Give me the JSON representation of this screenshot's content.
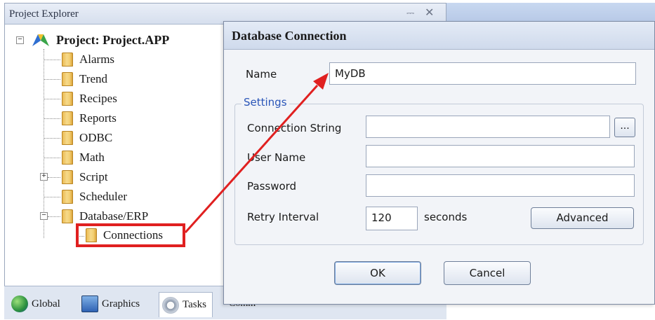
{
  "explorer": {
    "title": "Project Explorer",
    "project_label": "Project: Project.APP",
    "items": [
      {
        "label": "Alarms"
      },
      {
        "label": "Trend"
      },
      {
        "label": "Recipes"
      },
      {
        "label": "Reports"
      },
      {
        "label": "ODBC"
      },
      {
        "label": "Math"
      },
      {
        "label": "Script"
      },
      {
        "label": "Scheduler"
      },
      {
        "label": "Database/ERP"
      },
      {
        "label": "Connections"
      }
    ],
    "bottom_tabs": [
      {
        "label": "Global",
        "icon": "globe-icon"
      },
      {
        "label": "Graphics",
        "icon": "graphics-icon"
      },
      {
        "label": "Tasks",
        "icon": "gear-icon"
      },
      {
        "label": "Comm",
        "icon": "comm-icon"
      }
    ]
  },
  "dialog": {
    "title": "Database Connection",
    "name_label": "Name",
    "name_value": "MyDB",
    "settings_legend": "Settings",
    "connection_string_label": "Connection String",
    "connection_string_value": "",
    "ellipsis_label": "...",
    "user_name_label": "User Name",
    "user_name_value": "",
    "password_label": "Password",
    "password_value": "",
    "retry_interval_label": "Retry Interval",
    "retry_interval_value": "120",
    "retry_units": "seconds",
    "advanced_label": "Advanced",
    "ok_label": "OK",
    "cancel_label": "Cancel"
  },
  "colors": {
    "highlight": "#e02020",
    "settings_legend": "#2a55b8"
  }
}
